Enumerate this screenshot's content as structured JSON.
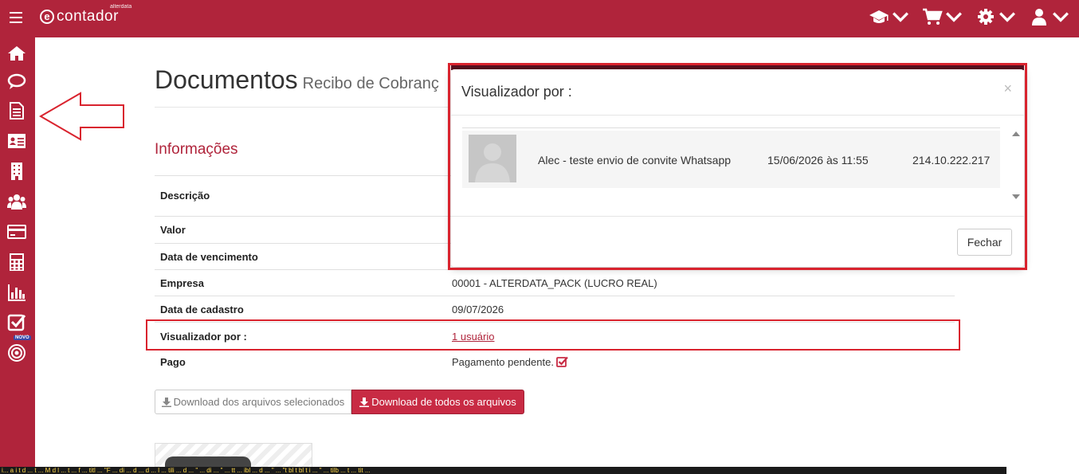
{
  "topbar": {
    "logo_text": "contador",
    "logo_small": "alterdata",
    "icons": [
      "graduation-cap-icon",
      "cart-icon",
      "gear-icon",
      "user-icon"
    ]
  },
  "sidebar": {
    "items": [
      "home-icon",
      "chat-icon",
      "document-icon",
      "id-card-icon",
      "building-icon",
      "users-icon",
      "credit-card-icon",
      "calculator-icon",
      "bar-chart-icon",
      "checkbox-icon",
      "target-icon"
    ],
    "novo_badge": "NOVO"
  },
  "page": {
    "title": "Documentos",
    "subtitle": "Recibo de Cobranç",
    "section_title": "Informações"
  },
  "info": {
    "descricao_label": "Descrição",
    "valor_label": "Valor",
    "vencimento_label": "Data de vencimento",
    "empresa_label": "Empresa",
    "empresa_value": "00001 - ALTERDATA_PACK (LUCRO REAL)",
    "cadastro_label": "Data de cadastro",
    "cadastro_value": "09/07/2026",
    "visualizador_label": "Visualizador por :",
    "visualizador_value": "1 usuário",
    "pago_label": "Pago",
    "pago_value": "Pagamento pendente."
  },
  "buttons": {
    "download_selected": "Download dos arquivos selecionados",
    "download_all": "Download de todos os arquivos"
  },
  "tooltip_text": "i... a i t d ... t ... M d l ... t ... f ... titl ... \"F ... di ... d ... d ... l ... tili ... d ... \" ... di ... \" ... tt ... ibl ... d ... \" ... \"t bl t bl t i ... \" ... tilb ... t ... tit ...",
  "modal": {
    "title": "Visualizador por :",
    "close": "×",
    "viewers": [
      {
        "name": "Alec - teste envio de convite Whatsapp",
        "date": "15/06/2026 às 11:55",
        "ip": "214.10.222.217"
      }
    ],
    "close_button": "Fechar"
  },
  "colors": {
    "brand": "#b0243b",
    "annotation": "#d9232e"
  }
}
